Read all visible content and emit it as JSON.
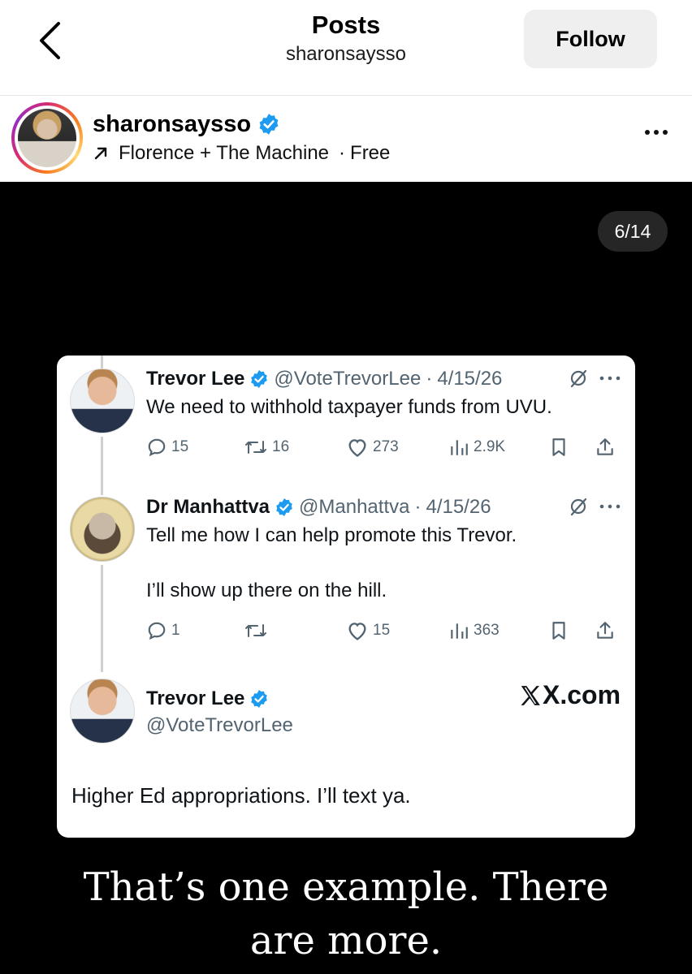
{
  "header": {
    "title": "Posts",
    "subtitle": "sharonsaysso",
    "follow_label": "Follow"
  },
  "author": {
    "username": "sharonsaysso",
    "audio": "Florence + The Machine",
    "separator": "·",
    "audio_tag": "Free",
    "verified": true
  },
  "media": {
    "counter": "6/14",
    "caption_line1": "That’s one example. There",
    "caption_line2": "are more."
  },
  "tweets": [
    {
      "name": "Trevor Lee",
      "handle": "@VoteTrevorLee",
      "date": "4/15/26",
      "text": "We need to withhold taxpayer funds from UVU.",
      "replies": "15",
      "reposts": "16",
      "likes": "273",
      "views": "2.9K"
    },
    {
      "name": "Dr Manhattva",
      "handle": "@Manhattva",
      "date": "4/15/26",
      "text_line1": "Tell me how I can help promote this Trevor.",
      "text_line2": "I’ll show up there on the hill.",
      "replies": "1",
      "reposts": "",
      "likes": "15",
      "views": "363"
    },
    {
      "name": "Trevor Lee",
      "handle": "@VoteTrevorLee",
      "text": "Higher Ed appropriations. I’ll text ya."
    }
  ],
  "source": "X.com",
  "colors": {
    "verified_blue": "#1d9bf0",
    "media_bg": "#000000",
    "follow_bg": "#efefef"
  }
}
